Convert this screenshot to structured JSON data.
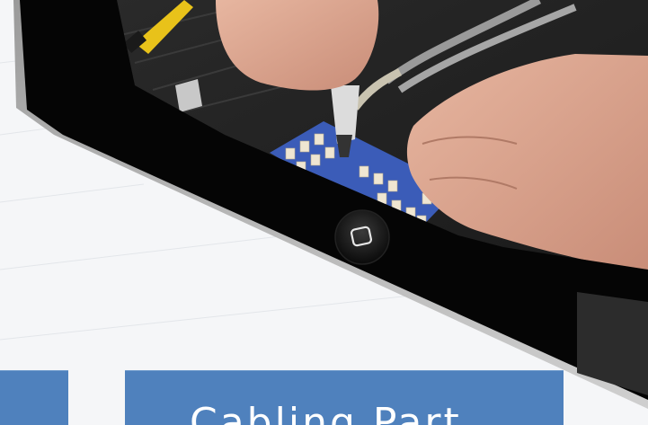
{
  "scene": {
    "subject": "tablet-photo",
    "home_button_icon": "rounded-square-icon"
  },
  "cards": [
    {
      "label": ""
    },
    {
      "label": "Cabling Part"
    }
  ],
  "colors": {
    "card_blue": "#4f81bd",
    "background": "#f5f6f8",
    "bezel": "#050505"
  }
}
